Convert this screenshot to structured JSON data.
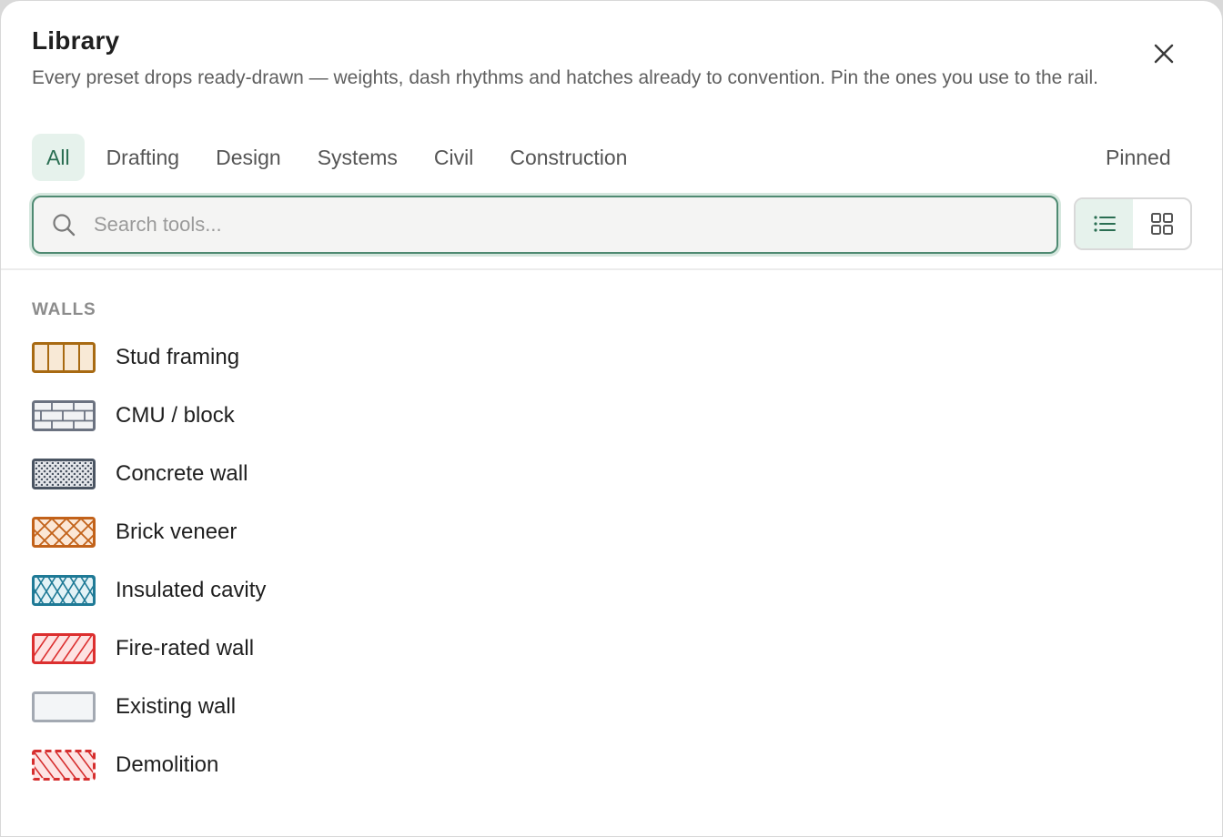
{
  "dialog": {
    "title": "Library",
    "description": "Every preset drops ready-drawn — weights, dash rhythms and hatches already to convention. Pin the ones you use to the rail.",
    "close_icon": "close-icon"
  },
  "tabs": [
    {
      "label": "All",
      "active": true
    },
    {
      "label": "Drafting",
      "active": false
    },
    {
      "label": "Design",
      "active": false
    },
    {
      "label": "Systems",
      "active": false
    },
    {
      "label": "Civil",
      "active": false
    },
    {
      "label": "Construction",
      "active": false
    }
  ],
  "pinned_label": "Pinned",
  "search": {
    "placeholder": "Search tools...",
    "value": "",
    "icon": "search-icon"
  },
  "view_toggle": {
    "options": [
      {
        "icon": "list-view-icon",
        "active": true
      },
      {
        "icon": "grid-view-icon",
        "active": false
      }
    ]
  },
  "sections": [
    {
      "label": "WALLS",
      "items": [
        {
          "label": "Stud framing",
          "swatch": "stud-framing-swatch",
          "color": "#a86a12"
        },
        {
          "label": "CMU / block",
          "swatch": "cmu-block-swatch",
          "color": "#6b7280"
        },
        {
          "label": "Concrete wall",
          "swatch": "concrete-wall-swatch",
          "color": "#4b5563"
        },
        {
          "label": "Brick veneer",
          "swatch": "brick-veneer-swatch",
          "color": "#c2621a"
        },
        {
          "label": "Insulated cavity",
          "swatch": "insulated-cavity-swatch",
          "color": "#1f7a96"
        },
        {
          "label": "Fire-rated wall",
          "swatch": "fire-rated-wall-swatch",
          "color": "#dc2f2f"
        },
        {
          "label": "Existing wall",
          "swatch": "existing-wall-swatch",
          "color": "#a3a9b2"
        },
        {
          "label": "Demolition",
          "swatch": "demolition-swatch",
          "color": "#d62f2f"
        }
      ]
    }
  ]
}
